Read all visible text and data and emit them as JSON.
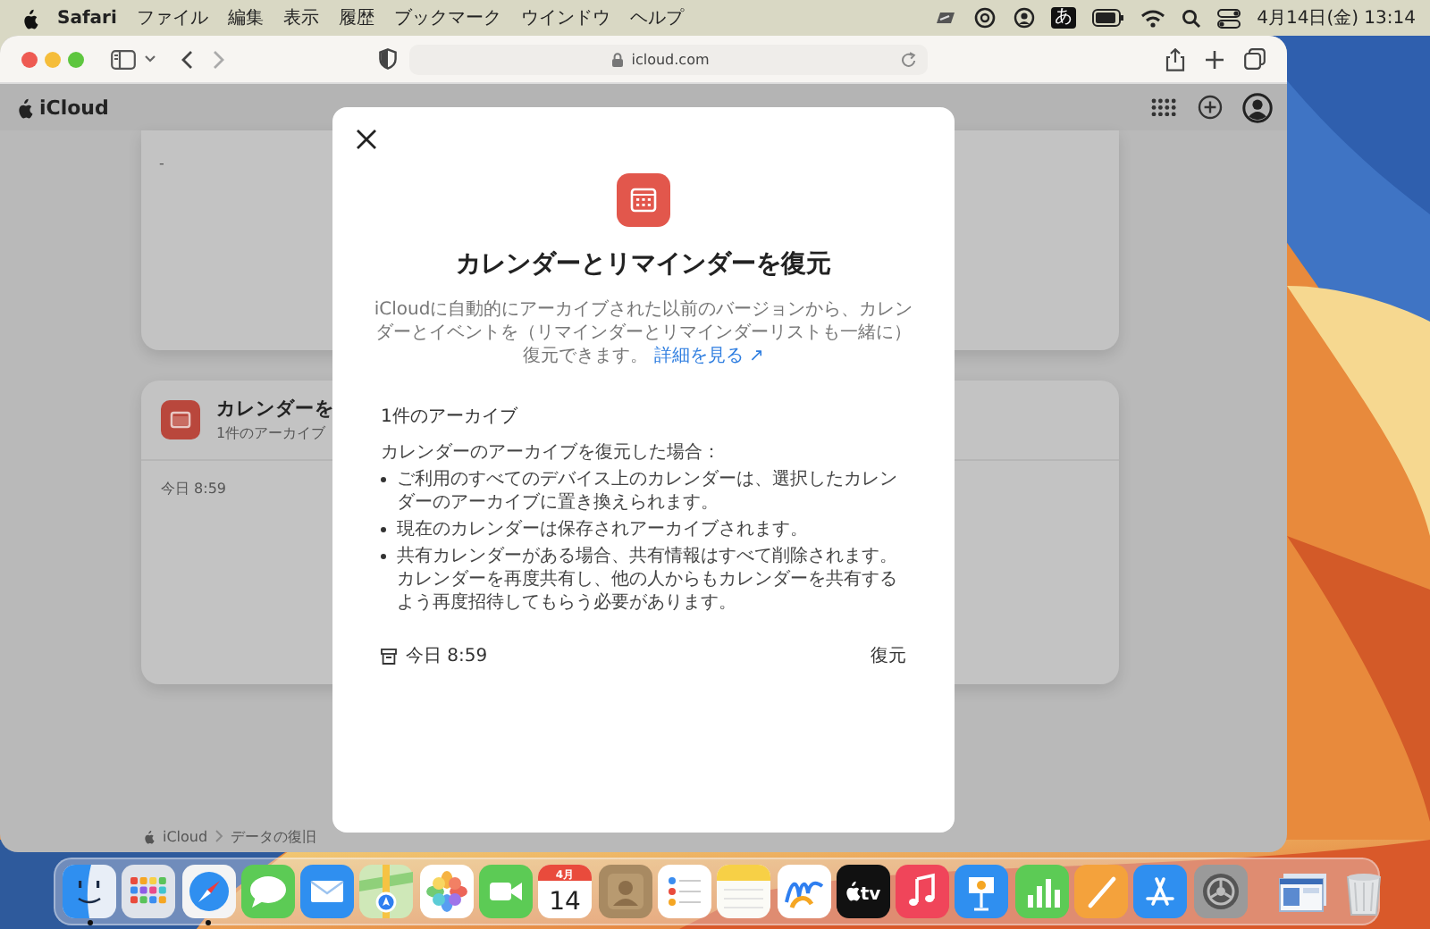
{
  "menu_bar": {
    "app": "Safari",
    "menus": [
      "ファイル",
      "編集",
      "表示",
      "履歴",
      "ブックマーク",
      "ウインドウ",
      "ヘルプ"
    ],
    "input_mode": "あ",
    "clock": "4月14日(金) 13:14"
  },
  "wallpaper": {
    "kind": "picture"
  },
  "browser": {
    "url": "icloud.com"
  },
  "site_header": {
    "title": "iCloud"
  },
  "cards": [
    {
      "kind": "note",
      "text": "-"
    },
    {
      "kind": "archive",
      "title": "カレンダーを",
      "subtitle": "1件のアーカイブ",
      "time": "今日 8:59"
    }
  ],
  "breadcrumb": [
    "iCloud",
    "データの復旧"
  ],
  "dialog": {
    "title": "カレンダーとリマインダーを復元",
    "description": "iCloudに自動的にアーカイブされた以前のバージョンから、カレンダーとイベントを（リマインダーとリマインダーリストも一緒に）復元できます。",
    "link": "詳細を見る ↗",
    "archive_heading": "1件のアーカイブ",
    "intro": "カレンダーのアーカイブを復元した場合：",
    "bullets": [
      "ご利用のすべてのデバイス上のカレンダーは、選択したカレンダーのアーカイブに置き換えられます。",
      "現在のカレンダーは保存されアーカイブされます。",
      "共有カレンダーがある場合、共有情報はすべて削除されます。カレンダーを再度共有し、他の人からもカレンダーを共有するよう再度招待してもらう必要があります。"
    ],
    "archive_time": "今日 8:59",
    "restore_button": "復元"
  },
  "dock": {
    "apps": [
      {
        "kind": "finder",
        "running": true
      },
      {
        "kind": "launchpad",
        "running": false
      },
      {
        "kind": "safari",
        "running": true
      },
      {
        "kind": "messages",
        "running": false
      },
      {
        "kind": "mail",
        "running": false
      },
      {
        "kind": "maps",
        "running": false
      },
      {
        "kind": "photos",
        "running": false
      },
      {
        "kind": "facetime",
        "running": false
      },
      {
        "kind": "calendar",
        "running": false,
        "month": "4月",
        "day": "14"
      },
      {
        "kind": "contacts",
        "running": false
      },
      {
        "kind": "reminders",
        "running": false
      },
      {
        "kind": "notes",
        "running": false
      },
      {
        "kind": "freeform",
        "running": false
      },
      {
        "kind": "tv",
        "running": false,
        "label": "tv"
      },
      {
        "kind": "music",
        "running": false
      },
      {
        "kind": "keynote",
        "running": false
      },
      {
        "kind": "numbers",
        "running": false
      },
      {
        "kind": "pages",
        "running": false
      },
      {
        "kind": "appstore",
        "running": false
      },
      {
        "kind": "settings",
        "running": false
      },
      {
        "kind": "divider"
      },
      {
        "kind": "windows",
        "running": false
      },
      {
        "kind": "trash",
        "running": false
      }
    ]
  }
}
